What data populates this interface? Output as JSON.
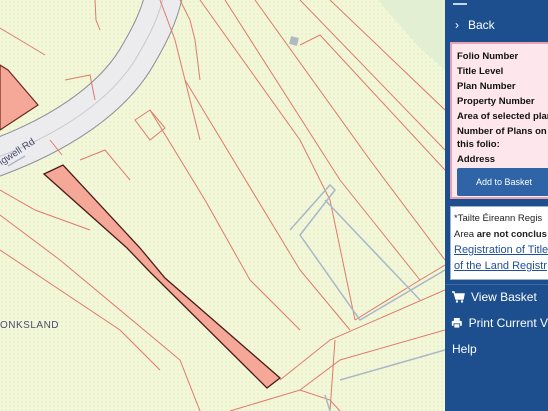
{
  "map": {
    "road_label": "Ingwell Rd",
    "townland_label": "ONKSLAND"
  },
  "panel": {
    "back_label": "Back",
    "fields": [
      "Folio Number",
      "Title Level",
      "Plan Number",
      "Property Number",
      "Area of selected plan",
      "Number of Plans on",
      "this folio:",
      "Address"
    ],
    "add_button_label": "Add to Basket",
    "note": {
      "line1": "*Tailte Éireann Regis",
      "line2_prefix": "Area ",
      "line2_bold": "are not conclus",
      "link1": "Registration of Title",
      "link2": "of the Land Registr"
    },
    "menu": {
      "view_basket": "View Basket",
      "print_current": "Print Current V",
      "help": "Help"
    }
  },
  "colors": {
    "panel_bg": "#1d4f8e",
    "button_bg": "#2f64a6",
    "info_bg": "#fde7ec",
    "selected_parcel_fill": "#f6a898",
    "boundary_line": "#e07a6a",
    "road_grey": "#c9c9cf"
  }
}
